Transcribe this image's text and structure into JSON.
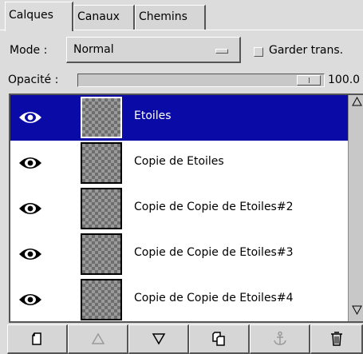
{
  "tabs": [
    {
      "label": "Calques"
    },
    {
      "label": "Canaux"
    },
    {
      "label": "Chemins"
    }
  ],
  "mode": {
    "label": "Mode :",
    "value": "Normal"
  },
  "keep_trans": {
    "label": "Garder trans.",
    "checked": false
  },
  "opacity": {
    "label": "Opacité :",
    "value": "100.0",
    "fraction": 1.0
  },
  "layers": [
    {
      "name": "Etoiles",
      "visible": true,
      "selected": true
    },
    {
      "name": "Copie de Etoiles",
      "visible": true,
      "selected": false
    },
    {
      "name": "Copie de Copie de Etoiles#2",
      "visible": true,
      "selected": false
    },
    {
      "name": "Copie de Copie de Etoiles#3",
      "visible": true,
      "selected": false
    },
    {
      "name": "Copie de Copie de Etoiles#4",
      "visible": true,
      "selected": false
    }
  ],
  "toolbar": [
    {
      "icon": "new-layer-icon",
      "enabled": true
    },
    {
      "icon": "raise-layer-icon",
      "enabled": false
    },
    {
      "icon": "lower-layer-icon",
      "enabled": true
    },
    {
      "icon": "duplicate-layer-icon",
      "enabled": true
    },
    {
      "icon": "anchor-layer-icon",
      "enabled": false
    },
    {
      "icon": "delete-layer-icon",
      "enabled": true
    }
  ],
  "colors": {
    "selection": "#0a0aa6",
    "background": "#dcdcdc"
  }
}
